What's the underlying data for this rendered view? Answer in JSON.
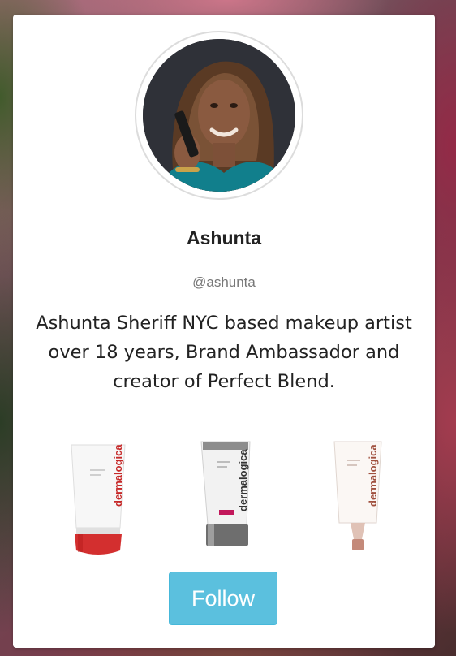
{
  "profile": {
    "name": "Ashunta",
    "handle": "@ashunta",
    "bio": "Ashunta Sheriff NYC based makeup artist over 18 years, Brand Ambassador and creator of Perfect Blend."
  },
  "products": [
    {
      "brand": "dermalogica",
      "cap_color": "#d32f2f"
    },
    {
      "brand": "dermalogica",
      "cap_color": "#6e6e6e"
    },
    {
      "brand": "dermalogica",
      "cap_color": "#c48a7a"
    }
  ],
  "follow_button": {
    "label": "Follow",
    "color": "#5bc0de"
  },
  "colors": {
    "card_bg": "#ffffff",
    "brand_red": "#c62828"
  }
}
